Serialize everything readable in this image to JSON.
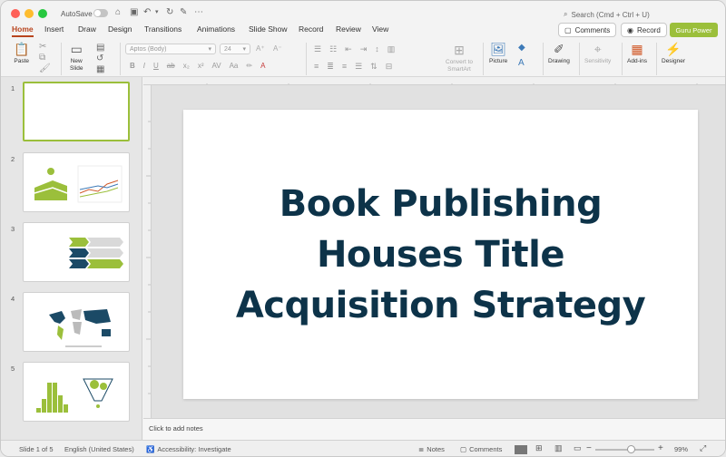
{
  "titlebar": {
    "autosave_label": "AutoSave",
    "search_placeholder": "Search (Cmd + Ctrl + U)"
  },
  "tabs": [
    {
      "label": "Home",
      "active": true
    },
    {
      "label": "Insert"
    },
    {
      "label": "Draw"
    },
    {
      "label": "Design"
    },
    {
      "label": "Transitions"
    },
    {
      "label": "Animations"
    },
    {
      "label": "Slide Show"
    },
    {
      "label": "Record"
    },
    {
      "label": "Review"
    },
    {
      "label": "View"
    }
  ],
  "header_buttons": {
    "comments": "Comments",
    "record": "Record",
    "guru": "Guru Power"
  },
  "ribbon": {
    "paste": "Paste",
    "new_slide_line1": "New",
    "new_slide_line2": "Slide",
    "font_name": "Aptos (Body)",
    "font_size": "24",
    "convert_line1": "Convert to",
    "convert_line2": "SmartArt",
    "picture": "Picture",
    "drawing": "Drawing",
    "sensitivity": "Sensitivity",
    "addins": "Add-ins",
    "designer": "Designer"
  },
  "slides": [
    {
      "number": "1"
    },
    {
      "number": "2"
    },
    {
      "number": "3"
    },
    {
      "number": "4"
    },
    {
      "number": "5"
    }
  ],
  "main_slide": {
    "title_line1": "Book Publishing",
    "title_line2": "Houses Title",
    "title_line3": "Acquisition Strategy",
    "title_color": "#0d3349"
  },
  "notes": {
    "placeholder": "Click to add notes"
  },
  "status": {
    "slide_info": "Slide 1 of 5",
    "language": "English (United States)",
    "accessibility": "Accessibility: Investigate",
    "notes": "Notes",
    "comments": "Comments",
    "zoom": "99%"
  },
  "colors": {
    "accent": "#b8451f",
    "brand_green": "#9bbf3b",
    "navy": "#0d3349"
  }
}
